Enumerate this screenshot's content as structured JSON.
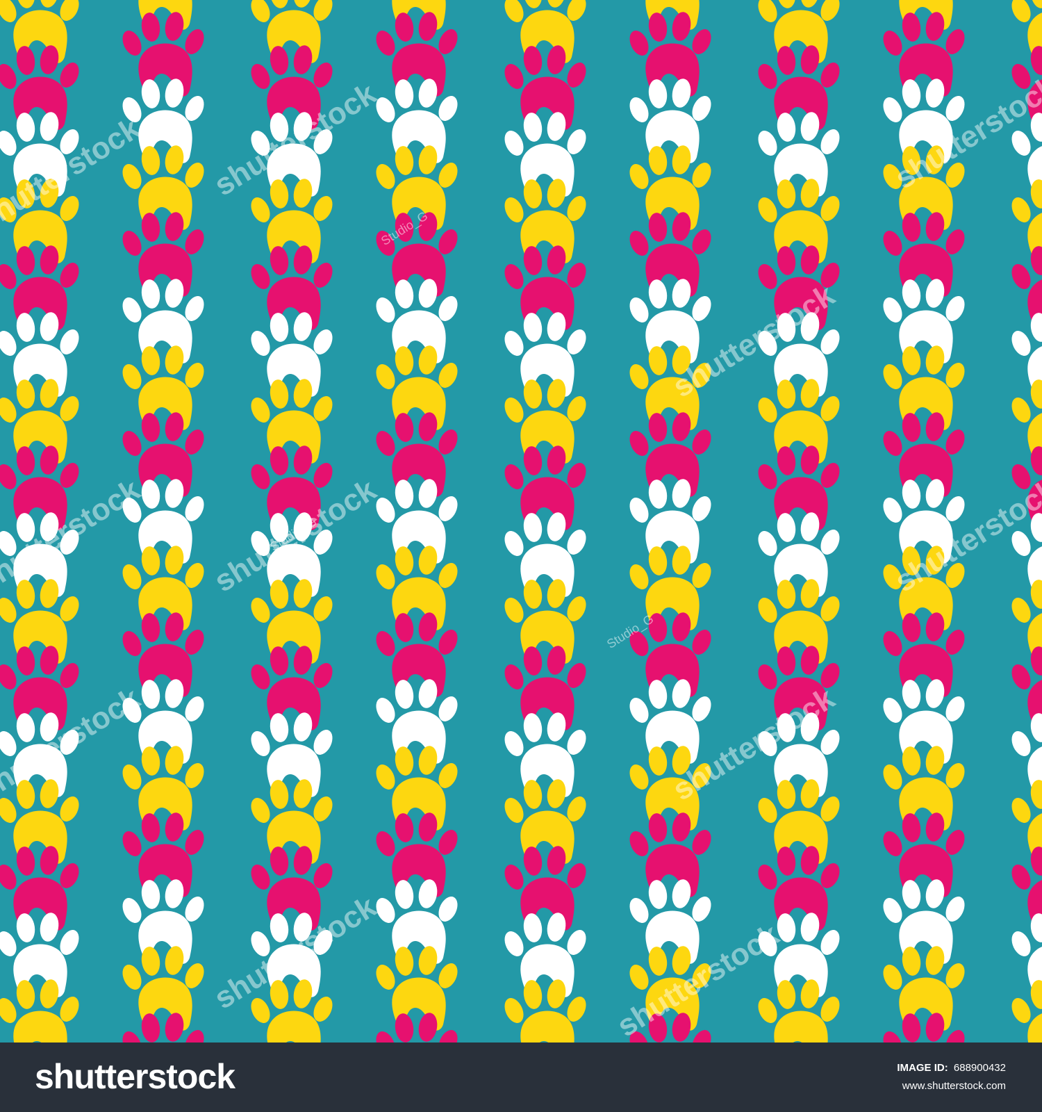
{
  "colors": {
    "background": "#2399a7",
    "paw_white": "#ffffff",
    "paw_yellow": "#fdd710",
    "paw_pink": "#e6116f",
    "footer": "#29303a"
  },
  "pattern": {
    "motif": "paw-print-icon",
    "row_cycle": [
      "white",
      "yellow",
      "pink"
    ]
  },
  "watermark": {
    "text": "shutterstock",
    "author": "Studio_G"
  },
  "footer": {
    "logo": "shutterstock",
    "image_id_label": "IMAGE ID:",
    "image_id": "688900432",
    "url": "www.shutterstock.com"
  }
}
